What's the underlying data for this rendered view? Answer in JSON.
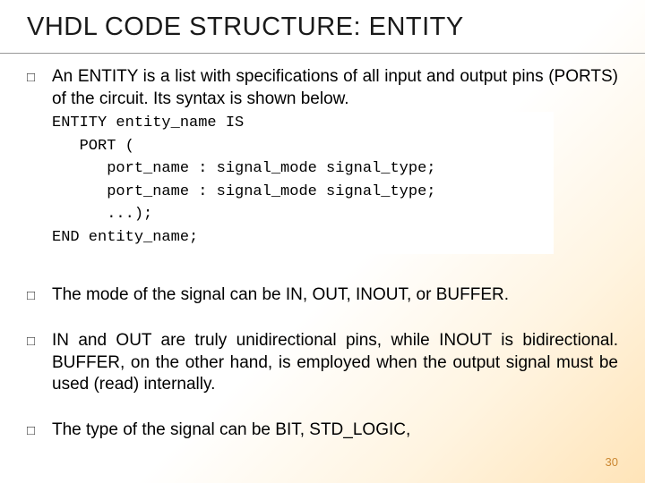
{
  "title": "VHDL CODE STRUCTURE: ENTITY",
  "bullets": {
    "b1": "An ENTITY is a list with specifications of all input and output pins (PORTS) of the circuit. Its syntax is shown below.",
    "b2": "The mode of the signal can be IN, OUT, INOUT, or BUFFER.",
    "b3": "IN and OUT are truly unidirectional pins, while INOUT is bidirectional. BUFFER, on the other hand, is employed when the output signal must be used (read) internally.",
    "b4": "The type of the signal can be BIT, STD_LOGIC,"
  },
  "code": "ENTITY entity_name IS\n   PORT (\n      port_name : signal_mode signal_type;\n      port_name : signal_mode signal_type;\n      ...);\nEND entity_name;",
  "slide_number": "30",
  "bullet_glyph": "□"
}
